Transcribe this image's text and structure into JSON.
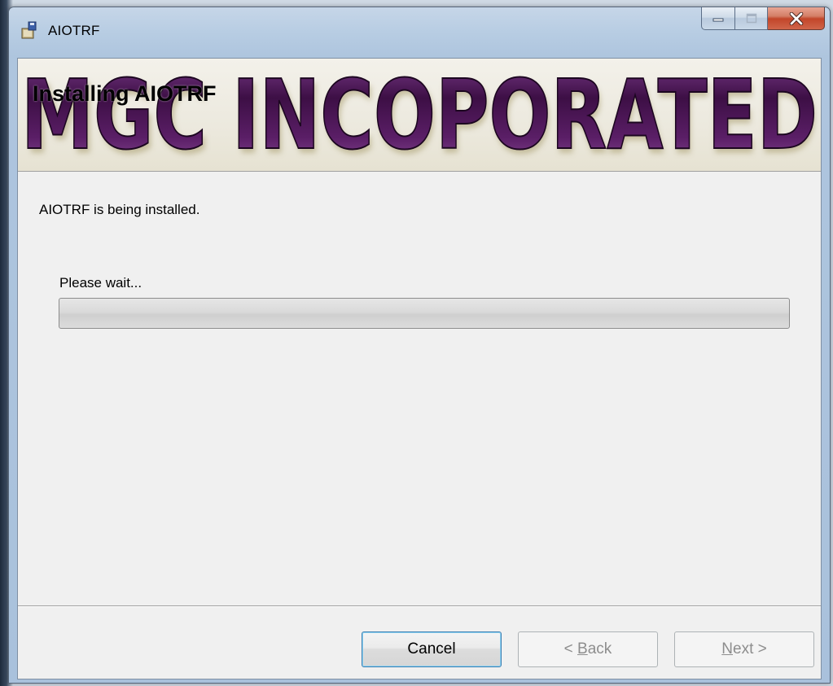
{
  "window": {
    "title": "AIOTRF",
    "icon": "installer-package-icon"
  },
  "caption_buttons": {
    "minimize_icon": "minimize-icon",
    "maximize_icon": "maximize-icon",
    "close_icon": "close-icon",
    "close_color": "#c2462a"
  },
  "banner": {
    "heading": "Installing AIOTRF",
    "logo_text": "MGC INCOPORATED",
    "logo_color": "#4a1450"
  },
  "body": {
    "status": "AIOTRF is being installed.",
    "wait_label": "Please wait...",
    "progress_fraction": 0.0
  },
  "buttons": {
    "cancel": "Cancel",
    "back_prefix": "< ",
    "back_accel": "B",
    "back_rest": "ack",
    "next_accel": "N",
    "next_rest": "ext >"
  }
}
